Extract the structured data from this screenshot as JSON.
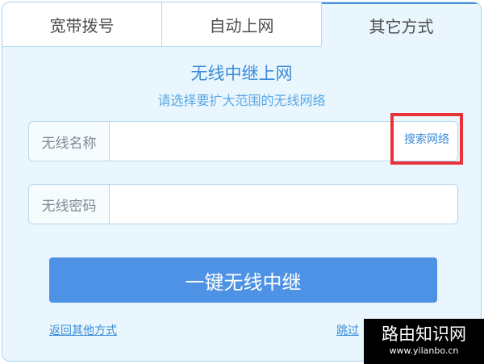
{
  "tabs": [
    {
      "label": "宽带拨号",
      "active": false
    },
    {
      "label": "自动上网",
      "active": false
    },
    {
      "label": "其它方式",
      "active": true
    }
  ],
  "heading": "无线中继上网",
  "subheading": "请选择要扩大范围的无线网络",
  "wifi_name": {
    "label": "无线名称",
    "value": "",
    "search_link": "搜索网络"
  },
  "wifi_password": {
    "label": "无线密码",
    "value": ""
  },
  "primary_button": "一键无线中继",
  "links": {
    "back": "返回其他方式",
    "skip": "跳过"
  },
  "watermark": {
    "title": "路由知识网",
    "url": "www.yilanbo.cn"
  },
  "colors": {
    "accent": "#4e92e5",
    "panel_bg": "#eaf6fd",
    "highlight_box": "#e8333b",
    "link": "#3a8cd8"
  }
}
